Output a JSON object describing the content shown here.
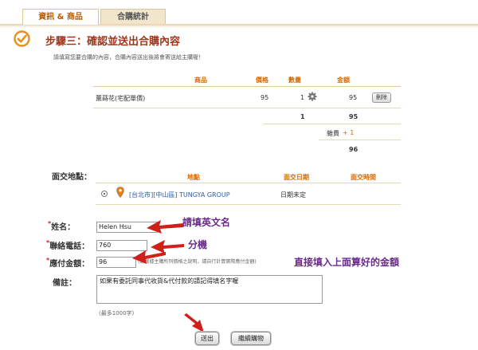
{
  "tabs": [
    {
      "label": "資訊 & 商品",
      "active": true
    },
    {
      "label": "合購統計",
      "active": false
    }
  ],
  "step": {
    "title": "步驟三：確認並送出合購內容",
    "description": "請填寫您要合購的內容，合購內容送出後將會寄送給主購喔！"
  },
  "product_table": {
    "headers": {
      "product": "商品",
      "price": "價格",
      "quantity": "數量",
      "amount": "金額"
    },
    "row": {
      "name": "薰蒔花(宅配單價)",
      "price": "95",
      "quantity": "1",
      "amount": "95",
      "delete_label": "刪除"
    },
    "totals": {
      "quantity": "1",
      "amount": "95",
      "fee_label": "雜費",
      "fee_value": "+ 1",
      "grand_total": "96"
    }
  },
  "pickup": {
    "label": "面交地點：",
    "headers": {
      "place": "地點",
      "date": "面交日期",
      "time": "面交時間"
    },
    "location": "[台北市][中山區] TUNGYA GROUP",
    "date": "日期未定"
  },
  "form": {
    "name_label": "姓名：",
    "name_value": "Helen Hsu",
    "phone_label": "聯絡電話：",
    "phone_value": "760",
    "amount_label": "應付金額：",
    "amount_value": "96",
    "amount_hint": "(請根據主購所列價格之說明，請自行計算實際應付金額)",
    "note_label": "備註：",
    "note_value": "如果有委託同事代收貨&代付款的請記得填名字喔",
    "note_limit": "(最多1000字)",
    "required_mark": "*"
  },
  "annotations": {
    "name": "請填英文名",
    "phone": "分機",
    "amount": "直接填入上面算好的金額"
  },
  "buttons": {
    "submit": "送出",
    "continue": "繼續購物"
  },
  "colors": {
    "heading": "#a0361c",
    "table_header": "#d86a00",
    "annotation": "#6b2a8c",
    "arrow": "#d0201a",
    "check_icon": "#e8901a"
  }
}
